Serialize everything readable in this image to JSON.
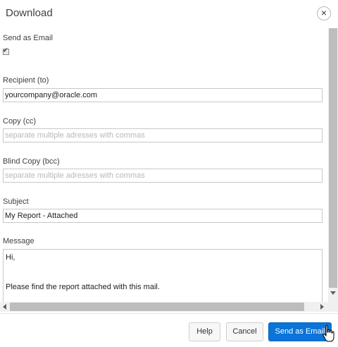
{
  "dialog": {
    "title": "Download",
    "close_label": "×"
  },
  "form": {
    "send_as_email_label": "Send as Email",
    "send_as_email_checked": true,
    "checkbox_mark": "✔",
    "recipient_label": "Recipient (to)",
    "recipient_value": "yourcompany@oracle.com",
    "cc_label": "Copy (cc)",
    "cc_placeholder": "separate multiple adresses with commas",
    "bcc_label": "Blind Copy (bcc)",
    "bcc_placeholder": "separate multiple adresses with commas",
    "subject_label": "Subject",
    "subject_value": "My Report - Attached",
    "message_label": "Message",
    "message_value": "Hi,\n\n\nPlease find the report attached with this mail."
  },
  "footer": {
    "help_label": "Help",
    "cancel_label": "Cancel",
    "send_label": "Send as Email"
  },
  "colors": {
    "primary": "#0a74d8",
    "text": "#404040",
    "border": "#c8c8c8"
  },
  "icons": {
    "close": "close-icon",
    "cursor": "hand-pointer-icon"
  }
}
